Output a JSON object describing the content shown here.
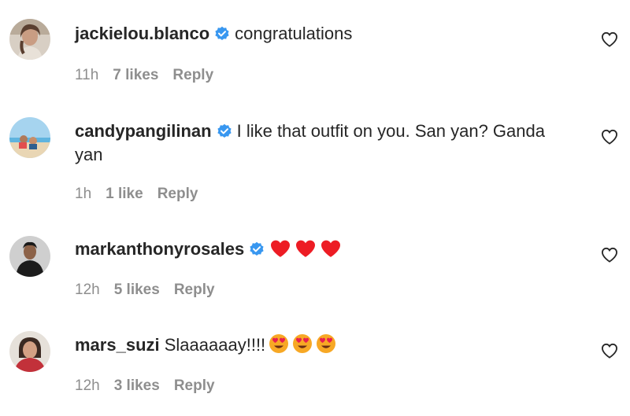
{
  "comments": [
    {
      "username": "jackielou.blanco",
      "text": "congratulations",
      "time": "11h",
      "likes": "7 likes",
      "reply": "Reply",
      "verified": true,
      "avatar_icon": "profile-photo-woman",
      "emojis": []
    },
    {
      "username": "candypangilinan",
      "text": "I like that outfit on you. San yan? Ganda",
      "text_line2": "yan",
      "time": "1h",
      "likes": "1 like",
      "reply": "Reply",
      "verified": true,
      "avatar_icon": "profile-photo-beach",
      "emojis": []
    },
    {
      "username": "markanthonyrosales",
      "text": "",
      "time": "12h",
      "likes": "5 likes",
      "reply": "Reply",
      "verified": true,
      "avatar_icon": "profile-photo-man",
      "emojis": [
        "red-heart",
        "red-heart",
        "red-heart"
      ]
    },
    {
      "username": "mars_suzi",
      "text": "Slaaaaaay!!!!",
      "time": "12h",
      "likes": "3 likes",
      "reply": "Reply",
      "verified": false,
      "avatar_icon": "profile-photo-woman-red",
      "emojis": [
        "heart-eyes",
        "heart-eyes",
        "heart-eyes"
      ]
    }
  ],
  "colors": {
    "text": "#262626",
    "meta": "#8e8e8e",
    "verified": "#3897f0",
    "heart": "#ed1c24"
  }
}
